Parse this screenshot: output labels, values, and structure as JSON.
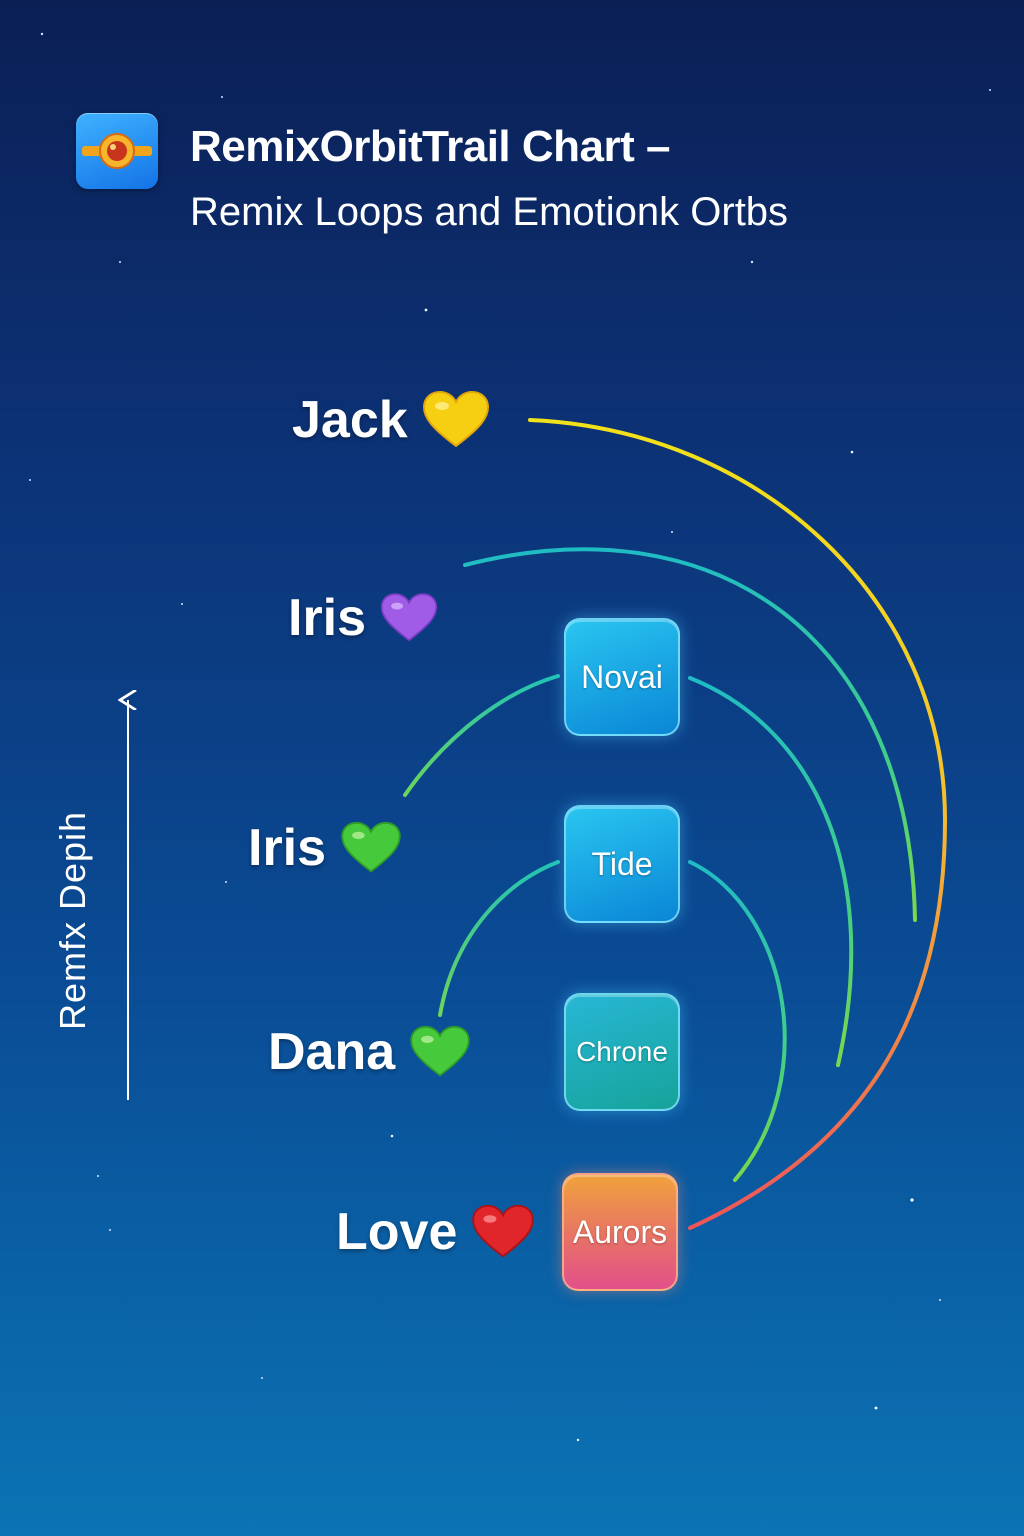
{
  "header": {
    "title": "RemixOrbitTrail Chart –",
    "subtitle": "Remix Loops and Emotionk Ortbs",
    "icon": "orbit-app-icon"
  },
  "axis": {
    "label": "Remfx Depih"
  },
  "people": [
    {
      "name": "Jack",
      "heart_icon": "yellow-heart-icon",
      "heart_color": "#f7cf12"
    },
    {
      "name": "Iris",
      "heart_icon": "purple-heart-icon",
      "heart_color": "#a05ce6"
    },
    {
      "name": "Iris",
      "heart_icon": "green-heart-icon",
      "heart_color": "#46c93a"
    },
    {
      "name": "Dana",
      "heart_icon": "green-heart-icon",
      "heart_color": "#46c93a"
    },
    {
      "name": "Love",
      "heart_icon": "red-heart-icon",
      "heart_color": "#e0262b"
    }
  ],
  "nodes": [
    {
      "label": "Novai"
    },
    {
      "label": "Tide"
    },
    {
      "label": "Chrone"
    },
    {
      "label": "Aurors"
    }
  ],
  "colors": {
    "background_top": "#0b1f55",
    "background_bottom": "#0b74b4",
    "arc_yellow": "#f2e21a",
    "arc_teal": "#22c3b4",
    "arc_green": "#4fd06a",
    "arc_red": "#f0545a"
  }
}
